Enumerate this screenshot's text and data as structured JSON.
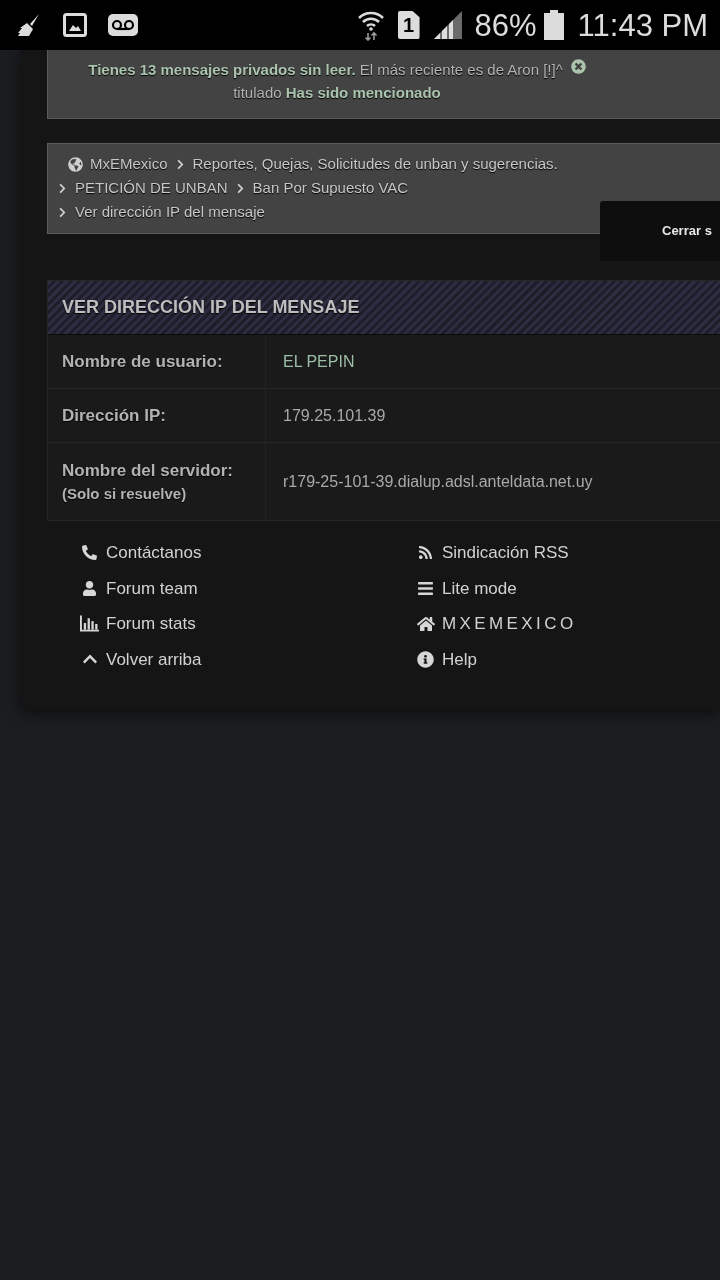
{
  "status_bar": {
    "sim_slot": "1",
    "battery_percent": "86%",
    "time": "11:43 PM"
  },
  "notification": {
    "line_1": "**Tienes 13 mensajes privados sin leer.** El más reciente es de Aron [!]^",
    "line_2": "titulado **Has sido mencionado**"
  },
  "breadcrumbs": [
    "MxEMexico",
    "Reportes, Quejas, Solicitudes de unban y sugerencias.",
    "PETICIÓN DE UNBAN",
    "Ban Por Supuesto VAC",
    "Ver dirección IP del mensaje"
  ],
  "tooltip": {
    "text": "Cerrar s"
  },
  "ip_panel": {
    "title": "VER DIRECCIÓN IP DEL MENSAJE",
    "rows": [
      {
        "label": "Nombre de usuario:",
        "value": "EL PEPIN",
        "kind": "user"
      },
      {
        "label": "Dirección IP:",
        "value": "179.25.101.39",
        "kind": "text"
      },
      {
        "label": "Nombre del servidor:",
        "note": "(Solo si resuelve)",
        "value": "r179-25-101-39.dialup.adsl.anteldata.net.uy",
        "kind": "text"
      }
    ]
  },
  "footer": {
    "columns": [
      [
        {
          "label": "Contáctanos",
          "kind": "link"
        },
        {
          "label": "Forum team",
          "kind": "link"
        },
        {
          "label": "Forum stats",
          "kind": "link"
        },
        {
          "label": "Volver arriba",
          "kind": "link"
        }
      ],
      [
        {
          "label": "Sindicación RSS",
          "kind": "link"
        },
        {
          "label": "Lite mode",
          "kind": "link"
        },
        {
          "label": "MXEMEXICO",
          "kind": "site"
        },
        {
          "label": "Help",
          "kind": "link"
        }
      ]
    ]
  }
}
